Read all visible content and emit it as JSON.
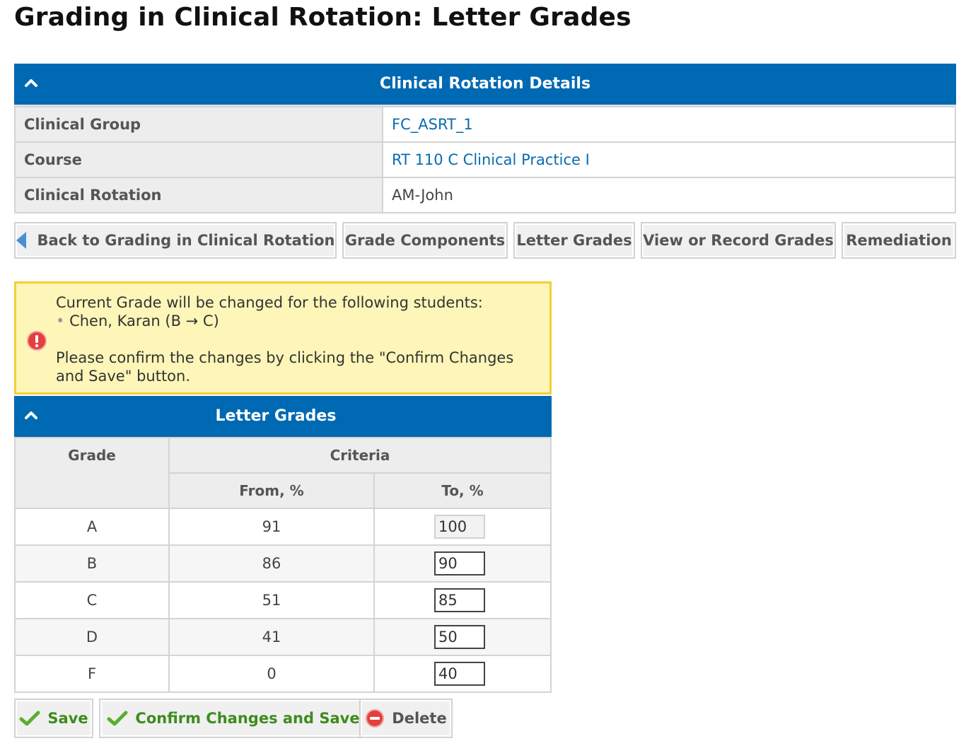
{
  "page": {
    "title": "Grading in Clinical Rotation: Letter Grades"
  },
  "details": {
    "header": "Clinical Rotation Details",
    "rows": [
      {
        "label": "Clinical Group",
        "value": "FC_ASRT_1"
      },
      {
        "label": "Course",
        "value": "RT 110 C Clinical Practice I"
      },
      {
        "label": "Clinical Rotation",
        "value": "AM-John"
      }
    ]
  },
  "toolbar": {
    "back_label": "Back to Grading in Clinical Rotation",
    "grade_components": "Grade Components",
    "letter_grades": "Letter Grades",
    "view_record": "View or Record Grades",
    "remediation": "Remediation"
  },
  "warning": {
    "line1": "Current Grade will be changed for the following students:",
    "bullet": "•",
    "student": "Chen, Karan (B → C)",
    "line2": "Please confirm the changes by clicking the \"Confirm Changes and Save\" button."
  },
  "grades": {
    "header": "Letter Grades",
    "col_grade": "Grade",
    "col_criteria": "Criteria",
    "col_from": "From, %",
    "col_to": "To, %",
    "rows": [
      {
        "grade": "A",
        "from": "91",
        "to": "100"
      },
      {
        "grade": "B",
        "from": "86",
        "to": "90"
      },
      {
        "grade": "C",
        "from": "51",
        "to": "85"
      },
      {
        "grade": "D",
        "from": "41",
        "to": "50"
      },
      {
        "grade": "F",
        "from": "0",
        "to": "40"
      }
    ]
  },
  "actions": {
    "save": "Save",
    "confirm_save": "Confirm Changes and Save",
    "delete": "Delete"
  },
  "colors": {
    "header_blue": "#0069b3",
    "link_blue": "#0a6bb0",
    "warning_bg": "#fdf6b8",
    "warning_border": "#f5cf35",
    "save_green": "#3d8c1e",
    "delete_red": "#e2403f"
  }
}
